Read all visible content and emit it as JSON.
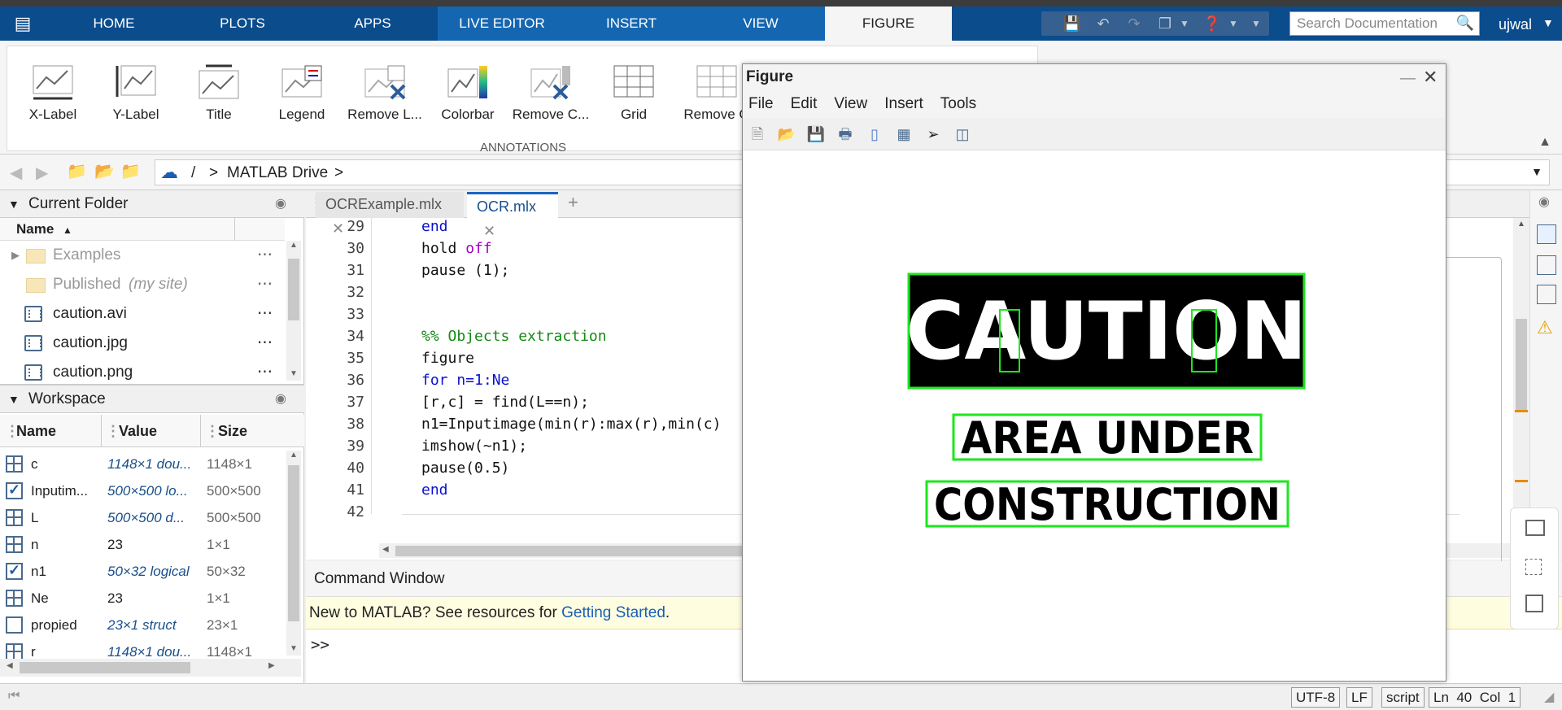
{
  "tabs": [
    "HOME",
    "PLOTS",
    "APPS",
    "LIVE EDITOR",
    "INSERT",
    "VIEW",
    "FIGURE"
  ],
  "search_placeholder": "Search Documentation",
  "user": "ujwal",
  "ribbon": {
    "buttons": [
      "X-Label",
      "Y-Label",
      "Title",
      "Legend",
      "Remove L...",
      "Colorbar",
      "Remove C...",
      "Grid",
      "Remove G"
    ],
    "group_label": "ANNOTATIONS"
  },
  "address": {
    "root": "/",
    "sep": ">",
    "folder": "MATLAB Drive"
  },
  "current_folder": {
    "title": "Current Folder",
    "col_name": "Name",
    "items": [
      {
        "name": "Examples",
        "extra": ""
      },
      {
        "name": "Published",
        "extra": "(my site)"
      },
      {
        "name": "caution.avi",
        "extra": ""
      },
      {
        "name": "caution.jpg",
        "extra": ""
      },
      {
        "name": "caution.png",
        "extra": ""
      }
    ]
  },
  "workspace": {
    "title": "Workspace",
    "cols": [
      "Name",
      "Value",
      "Size"
    ],
    "rows": [
      {
        "name": "c",
        "value": "1148×1 dou...",
        "size": "1148×1",
        "icon": "grid"
      },
      {
        "name": "Inputim...",
        "value": "500×500 lo...",
        "size": "500×500",
        "icon": "check"
      },
      {
        "name": "L",
        "value": "500×500 d...",
        "size": "500×500",
        "icon": "grid"
      },
      {
        "name": "n",
        "value": "23",
        "size": "1×1",
        "icon": "grid"
      },
      {
        "name": "n1",
        "value": "50×32 logical",
        "size": "50×32",
        "icon": "check"
      },
      {
        "name": "Ne",
        "value": "23",
        "size": "1×1",
        "icon": "grid"
      },
      {
        "name": "propied",
        "value": "23×1 struct",
        "size": "23×1",
        "icon": "struct"
      },
      {
        "name": "r",
        "value": "1148×1 dou...",
        "size": "1148×1",
        "icon": "grid"
      }
    ]
  },
  "editor": {
    "tabs": [
      "OCRExample.mlx",
      "OCR.mlx"
    ],
    "lines": [
      {
        "n": "29",
        "code": "end"
      },
      {
        "n": "30",
        "code": "hold off"
      },
      {
        "n": "31",
        "code": "pause (1);"
      },
      {
        "n": "32",
        "code": ""
      },
      {
        "n": "33",
        "code": ""
      },
      {
        "n": "34",
        "code": "%% Objects extraction"
      },
      {
        "n": "35",
        "code": "figure"
      },
      {
        "n": "36",
        "code": "for n=1:Ne"
      },
      {
        "n": "37",
        "code": "[r,c] = find(L==n);"
      },
      {
        "n": "38",
        "code": "n1=Inputimage(min(r):max(r),min(c)"
      },
      {
        "n": "39",
        "code": "imshow(~n1);"
      },
      {
        "n": "40",
        "code": "pause(0.5)"
      },
      {
        "n": "41",
        "code": "end"
      },
      {
        "n": "42",
        "code": ""
      }
    ]
  },
  "command_window": {
    "title": "Command Window",
    "info_prefix": "New to MATLAB? See resources for ",
    "info_link": "Getting Started",
    "info_suffix": ".",
    "prompt": ">>"
  },
  "status": {
    "encoding": "UTF-8",
    "eol": "LF",
    "type": "script",
    "pos": "Ln  40  Col  1"
  },
  "figure": {
    "title": "Figure",
    "menus": [
      "File",
      "Edit",
      "View",
      "Insert",
      "Tools"
    ],
    "image_line1": "CAUTION",
    "image_line2": "AREA UNDER",
    "image_line3": "CONSTRUCTION"
  }
}
